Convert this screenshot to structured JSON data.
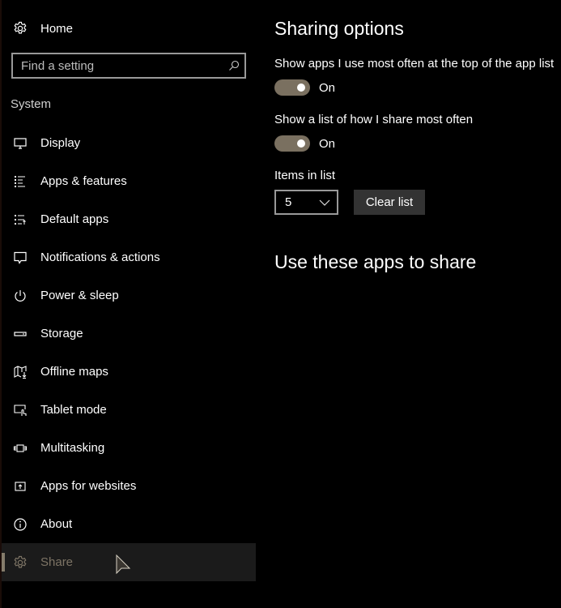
{
  "sidebar": {
    "home_label": "Home",
    "search_placeholder": "Find a setting",
    "section_title": "System",
    "items": [
      {
        "label": "Display",
        "icon": "monitor-icon"
      },
      {
        "label": "Apps & features",
        "icon": "list-icon"
      },
      {
        "label": "Default apps",
        "icon": "default-apps-icon"
      },
      {
        "label": "Notifications & actions",
        "icon": "notification-icon"
      },
      {
        "label": "Power & sleep",
        "icon": "power-icon"
      },
      {
        "label": "Storage",
        "icon": "storage-icon"
      },
      {
        "label": "Offline maps",
        "icon": "map-download-icon"
      },
      {
        "label": "Tablet mode",
        "icon": "tablet-mode-icon"
      },
      {
        "label": "Multitasking",
        "icon": "multitasking-icon"
      },
      {
        "label": "Apps for websites",
        "icon": "apps-websites-icon"
      },
      {
        "label": "About",
        "icon": "info-icon"
      },
      {
        "label": "Share",
        "icon": "gear-icon",
        "selected": true
      }
    ]
  },
  "main": {
    "title": "Sharing options",
    "settings": [
      {
        "label": "Show apps I use most often at the top of the app list",
        "state": "On",
        "enabled": true
      },
      {
        "label": "Show a list of how I share most often",
        "state": "On",
        "enabled": true
      }
    ],
    "items_in_list": {
      "label": "Items in list",
      "value": "5"
    },
    "clear_button": "Clear list",
    "section2_title": "Use these apps to share"
  },
  "colors": {
    "accent": "#7a7060",
    "selected_text": "#7d7465",
    "selected_bg": "#1b1b1b",
    "button_bg": "#333333"
  }
}
